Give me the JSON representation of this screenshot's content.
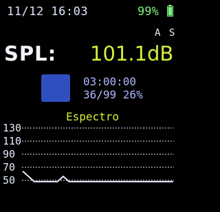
{
  "status": {
    "datetime": "11/12 16:03",
    "battery_percent": "99%",
    "battery_level": 0.99
  },
  "weighting": "A S",
  "spl": {
    "label": "SPL:",
    "value": "101.1dB"
  },
  "measurement": {
    "elapsed": "03:00:00",
    "memory": "36/99 26%"
  },
  "colors": {
    "value": "#d8ee3a",
    "info": "#aeb8ff",
    "indicator": "#2f4fbf",
    "battery": "#7ef07e",
    "text": "#e6ecff"
  },
  "spectrum": {
    "title": "Espectro"
  },
  "chart_data": {
    "type": "line",
    "title": "Espectro",
    "y_ticks": [
      "130",
      "110",
      "90",
      "70",
      "50"
    ],
    "ylim": [
      46,
      134
    ],
    "grid": true,
    "x": [
      0,
      1,
      2,
      3,
      4,
      5,
      6,
      7,
      8,
      9,
      10,
      11,
      12,
      13,
      14,
      15,
      16,
      17,
      18,
      19,
      20,
      21,
      22,
      23,
      24,
      25,
      26
    ],
    "values": [
      64,
      56,
      48,
      48,
      48,
      48,
      48,
      56,
      48,
      48,
      48,
      48,
      48,
      48,
      48,
      48,
      48,
      48,
      48,
      48,
      48,
      48,
      48,
      48,
      48,
      48,
      48
    ]
  }
}
